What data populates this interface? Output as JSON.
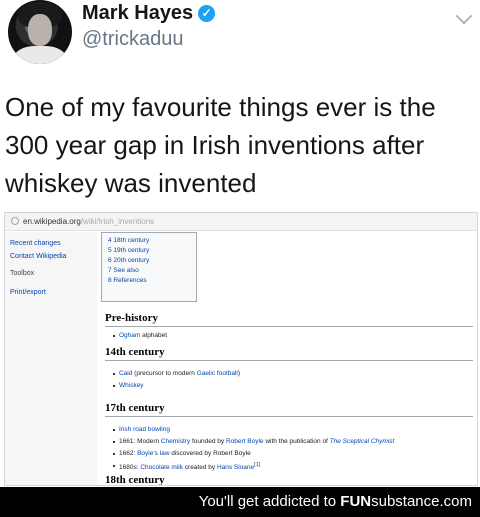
{
  "tweet": {
    "display_name": "Mark Hayes",
    "handle": "@trickaduu",
    "text": "One of my favourite things ever is the 300 year gap in Irish inventions after whiskey was invented"
  },
  "wiki": {
    "url_domain": "en.wikipedia.org",
    "url_path": "/wiki/Irish_inventions",
    "sidebar": {
      "links": [
        "Recent changes",
        "Contact Wikipedia"
      ],
      "toolbox": "Toolbox",
      "print_export": "Print/export"
    },
    "toc": [
      "4 18th century",
      "5 19th century",
      "6 20th century",
      "7 See also",
      "8 References"
    ],
    "sections": {
      "prehistory": {
        "heading": "Pre-history",
        "items": [
          {
            "link": "Ogham",
            "rest": " alphabet"
          }
        ]
      },
      "c14": {
        "heading": "14th century",
        "items": [
          {
            "link": "Caid",
            "rest1": " (precursor to modern ",
            "link2": "Gaelic football",
            "rest2": ")"
          },
          {
            "link": "Whiskey"
          }
        ]
      },
      "c17": {
        "heading": "17th century",
        "items": [
          {
            "link": "Irish road bowling"
          },
          {
            "prefix": "1661: Modern ",
            "link": "Chemistry",
            "mid": " founded by ",
            "link2": "Robert Boyle",
            "mid2": " with the publication of ",
            "ital": "The Sceptical Chymist"
          },
          {
            "prefix": "1662: ",
            "link": "Boyle's law",
            "mid": " discovered by Robert Boyle"
          },
          {
            "prefix": "1680s: ",
            "link": "Chocolate milk",
            "mid": " created by ",
            "link2": "Hans Sloane",
            "sup": "[1]"
          }
        ]
      },
      "c18": {
        "heading": "18th century"
      }
    }
  },
  "footer": {
    "prefix": "You'll get addicted to ",
    "brand_bold": "FUN",
    "brand_rest": "substance.com"
  }
}
